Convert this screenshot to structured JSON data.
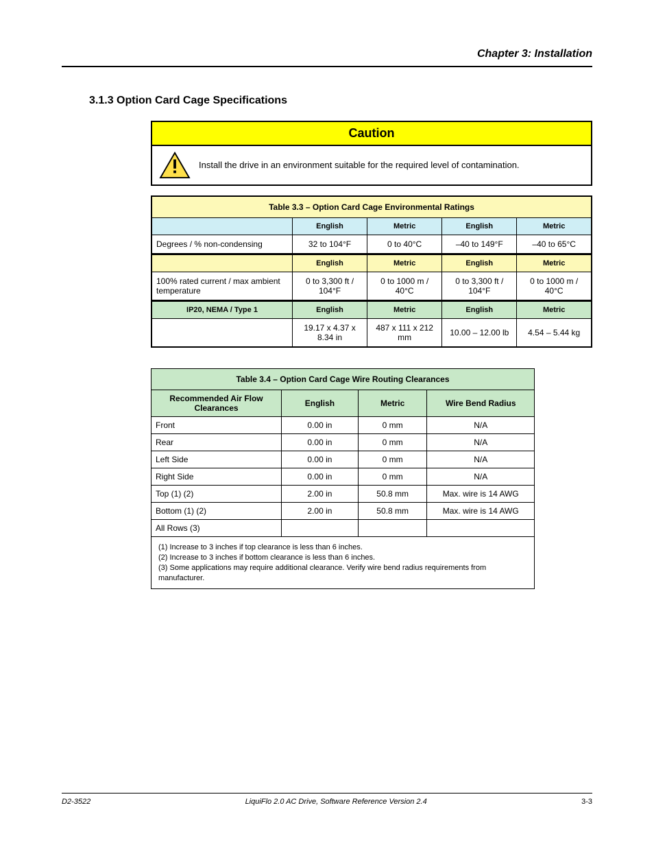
{
  "header": {
    "right": "Chapter 3: Installation"
  },
  "section_heading": "3.1.3 Option Card Cage Specifications",
  "caution": {
    "title": "Caution",
    "text": "Install the drive in an environment suitable for the required level of contamination."
  },
  "table1": {
    "title": "Table 3.3 – Option Card Cage Environmental Ratings",
    "group1": {
      "headers": [
        "",
        "English",
        "Metric",
        "English",
        "Metric"
      ],
      "row": {
        "label": "Degrees / % non-condensing",
        "v1": "32 to 104°F",
        "v2": "0 to 40°C",
        "v3": "–40 to 149°F",
        "v4": "–40 to 65°C"
      }
    },
    "group2": {
      "headers": [
        "",
        "English",
        "Metric",
        "English",
        "Metric"
      ],
      "row": {
        "label": "100% rated current / max ambient temperature",
        "v1": "0 to 3,300 ft / 104°F",
        "v2": "0 to 1000 m / 40°C",
        "v3": "0 to 3,300 ft / 104°F",
        "v4": "0 to 1000 m / 40°C"
      }
    },
    "group3": {
      "headers": [
        "IP20, NEMA / Type 1",
        "English",
        "Metric",
        "English",
        "Metric"
      ],
      "row": {
        "label": "",
        "v1": "19.17 x 4.37 x 8.34 in",
        "v2": "487 x 111 x 212 mm",
        "v3": "10.00 – 12.00 lb",
        "v4": "4.54 – 5.44 kg"
      }
    }
  },
  "table2": {
    "title": "Table 3.4 – Option Card Cage Wire Routing Clearances",
    "headers": [
      "Recommended Air Flow Clearances",
      "English",
      "Metric",
      "Wire Bend Radius"
    ],
    "rows": [
      {
        "c1": "Front",
        "c2": "0.00 in",
        "c3": "0 mm",
        "c4": "N/A"
      },
      {
        "c1": "Rear",
        "c2": "0.00 in",
        "c3": "0 mm",
        "c4": "N/A"
      },
      {
        "c1": "Left Side",
        "c2": "0.00 in",
        "c3": "0 mm",
        "c4": "N/A"
      },
      {
        "c1": "Right Side",
        "c2": "0.00 in",
        "c3": "0 mm",
        "c4": "N/A"
      },
      {
        "c1": "Top (1) (2)",
        "c2": "2.00 in",
        "c3": "50.8 mm",
        "c4": "Max. wire is 14 AWG"
      },
      {
        "c1": "Bottom (1) (2)",
        "c2": "2.00 in",
        "c3": "50.8 mm",
        "c4": "Max. wire is 14 AWG"
      },
      {
        "c1": "All Rows (3)",
        "c2": "",
        "c3": "",
        "c4": ""
      }
    ],
    "footnote": "(1) Increase to 3 inches if top clearance is less than 6 inches.\n(2) Increase to 3 inches if bottom clearance is less than 6 inches.\n(3) Some applications may require additional clearance. Verify wire bend radius requirements from manufacturer."
  },
  "footer": {
    "left": "D2-3522",
    "center": "LiquiFlo 2.0 AC Drive, Software Reference Version 2.4",
    "right": "3-3"
  }
}
